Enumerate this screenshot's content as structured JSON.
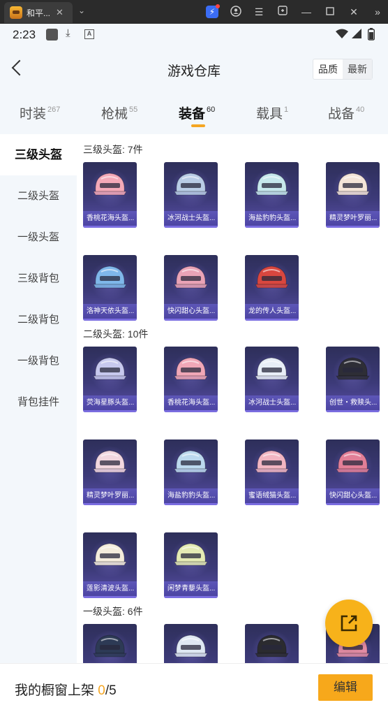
{
  "window": {
    "tab_title": "和平...",
    "close": "✕",
    "dropdown": "⌄"
  },
  "status": {
    "time": "2:23"
  },
  "header": {
    "title": "游戏仓库",
    "sort_quality": "品质",
    "sort_latest": "最新"
  },
  "tabs": [
    {
      "label": "时装",
      "count": "267"
    },
    {
      "label": "枪械",
      "count": "55"
    },
    {
      "label": "装备",
      "count": "60",
      "active": true
    },
    {
      "label": "载具",
      "count": "1"
    },
    {
      "label": "战备",
      "count": "40"
    }
  ],
  "sidebar": [
    {
      "label": "三级头盔",
      "active": true
    },
    {
      "label": "二级头盔"
    },
    {
      "label": "一级头盔"
    },
    {
      "label": "三级背包"
    },
    {
      "label": "二级背包"
    },
    {
      "label": "一级背包"
    },
    {
      "label": "背包挂件"
    }
  ],
  "sections": [
    {
      "title": "三级头盔: 7件",
      "items": [
        {
          "name": "香桃花海头盔...",
          "color": "#f4a9b8"
        },
        {
          "name": "冰河战士头盔...",
          "color": "#b9cde6"
        },
        {
          "name": "海盐豹豹头盔...",
          "color": "#c6e8ec"
        },
        {
          "name": "精灵梦叶罗丽...",
          "color": "#f3e4d8"
        },
        {
          "name": "洛神天依头盔...",
          "color": "#7fb7ea"
        },
        {
          "name": "快闪甜心头盔...",
          "color": "#e9a3b6"
        },
        {
          "name": "龙的传人头盔...",
          "color": "#d9473f"
        }
      ]
    },
    {
      "title": "二级头盔: 10件",
      "items": [
        {
          "name": "荧海星豚头盔...",
          "color": "#c7c9ee"
        },
        {
          "name": "香桃花海头盔...",
          "color": "#f0a7b7"
        },
        {
          "name": "冰河战士头盔...",
          "color": "#e8eef7"
        },
        {
          "name": "创世・救赎头...",
          "color": "#2e2e36"
        },
        {
          "name": "精灵梦叶罗丽...",
          "color": "#f2d7df"
        },
        {
          "name": "海盐豹豹头盔...",
          "color": "#bcd9ee"
        },
        {
          "name": "蜜语绒猫头盔...",
          "color": "#f2b6c2"
        },
        {
          "name": "快闪甜心头盔...",
          "color": "#e27f97"
        },
        {
          "name": "莲影清波头盔...",
          "color": "#f4ecdc"
        },
        {
          "name": "闲梦青藜头盔...",
          "color": "#e4eab4"
        }
      ]
    },
    {
      "title": "一级头盔: 6件",
      "items": [
        {
          "name": "",
          "color": "#2d3a55"
        },
        {
          "name": "",
          "color": "#dfe8f3"
        },
        {
          "name": "",
          "color": "#2b2b2f"
        },
        {
          "name": "",
          "color": "#e28ca4"
        }
      ]
    }
  ],
  "bottom": {
    "label": "我的橱窗上架",
    "count": "0",
    "total": "/5",
    "edit": "编辑"
  }
}
